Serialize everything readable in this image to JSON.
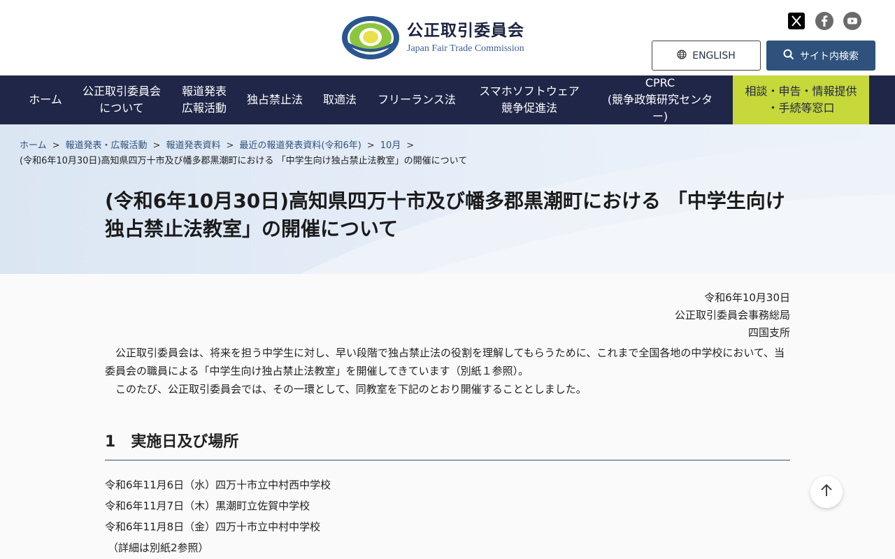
{
  "header": {
    "logo_jp": "公正取引委員会",
    "logo_en": "Japan Fair Trade Commission",
    "english_label": "ENGLISH",
    "search_label": "サイト内検索",
    "social": [
      "x-icon",
      "facebook-icon",
      "youtube-icon"
    ]
  },
  "nav": {
    "items": [
      {
        "l1": "ホーム",
        "l2": ""
      },
      {
        "l1": "公正取引委員会",
        "l2": "について"
      },
      {
        "l1": "報道発表",
        "l2": "広報活動"
      },
      {
        "l1": "独占禁止法",
        "l2": ""
      },
      {
        "l1": "取適法",
        "l2": ""
      },
      {
        "l1": "フリーランス法",
        "l2": ""
      },
      {
        "l1": "スマホソフトウェア",
        "l2": "競争促進法"
      },
      {
        "l1": "CPRC",
        "l2": "(競争政策研究センター)"
      }
    ],
    "consult": {
      "l1": "相談・申告・情報提供",
      "l2": "・手続等窓口"
    }
  },
  "breadcrumb": {
    "items": [
      "ホーム",
      "報道発表・広報活動",
      "報道発表資料",
      "最近の報道発表資料(令和6年)",
      "10月"
    ],
    "separator": ">",
    "current": "(令和6年10月30日)高知県四万十市及び幡多郡黒潮町における 「中学生向け独占禁止法教室」の開催について"
  },
  "page": {
    "title": "(令和6年10月30日)高知県四万十市及び幡多郡黒潮町における 「中学生向け独占禁止法教室」の開催について",
    "date": "令和6年10月30日",
    "issuer": "公正取引委員会事務総局",
    "branch": "四国支所",
    "para1": "公正取引委員会は、将来を担う中学生に対し、早い段階で独占禁止法の役割を理解してもらうために、これまで全国各地の中学校において、当委員会の職員による「中学生向け独占禁止法教室」を開催してきています（別紙１参照）。",
    "para2": "このたび、公正取引委員会では、その一環として、同教室を下記のとおり開催することとしました。",
    "section1_num": "1",
    "section1_title": "実施日及び場所",
    "schedule": [
      "令和6年11月6日（水）四万十市立中村西中学校",
      "令和6年11月7日（木）黒潮町立佐賀中学校",
      "令和6年11月8日（金）四万十市立中村中学校"
    ],
    "schedule_note": "（詳細は別紙2参照）"
  },
  "colors": {
    "nav_bg": "#1f2647",
    "consult_bg": "#c6d83a",
    "accent": "#2e527b"
  }
}
